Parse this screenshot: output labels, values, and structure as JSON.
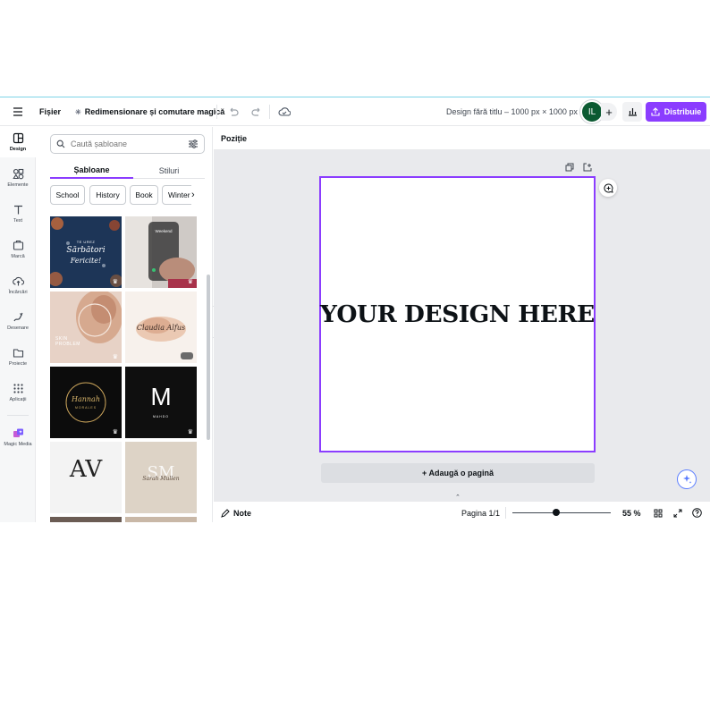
{
  "topbar": {
    "file_label": "Fișier",
    "magic_resize_label": "Redimensionare și comutare magică",
    "doc_title": "Design fără titlu – 1000 px × 1000 px",
    "avatar_initials": "IL",
    "share_label": "Distribuie",
    "icons": [
      "menu-icon",
      "sparkle-icon",
      "undo-icon",
      "redo-icon",
      "cloud-icon",
      "plus-icon",
      "insights-icon",
      "upload-icon"
    ]
  },
  "rail": {
    "items": [
      {
        "label": "Design",
        "icon": "design-icon"
      },
      {
        "label": "Elemente",
        "icon": "elements-icon"
      },
      {
        "label": "Text",
        "icon": "text-icon"
      },
      {
        "label": "Marcă",
        "icon": "brand-icon"
      },
      {
        "label": "Încărcări",
        "icon": "upload-cloud-icon"
      },
      {
        "label": "Desenare",
        "icon": "draw-icon"
      },
      {
        "label": "Proiecte",
        "icon": "folder-icon"
      },
      {
        "label": "Aplicații",
        "icon": "apps-icon"
      },
      {
        "label": "Magic Media",
        "icon": "magic-media-icon"
      }
    ]
  },
  "panel": {
    "search_placeholder": "Caută șabloane",
    "tabs": [
      "Șabloane",
      "Stiluri"
    ],
    "chips": [
      "School",
      "History",
      "Book",
      "Winter"
    ],
    "templates": [
      {
        "lines": [
          "TE UREZ",
          "Sărbători",
          "Fericite!"
        ]
      },
      {
        "lines": [
          "Weekend"
        ]
      },
      {
        "lines": [
          "SKIN",
          "PROBLEM"
        ]
      },
      {
        "lines": [
          "Claudia Alfus"
        ]
      },
      {
        "lines": [
          "Hannah",
          "MORALES"
        ]
      },
      {
        "lines": [
          "M",
          "MAHDO"
        ]
      },
      {
        "lines": [
          "AV"
        ]
      },
      {
        "lines": [
          "SM",
          "Sarah Mullen"
        ]
      }
    ]
  },
  "workspace": {
    "position_label": "Poziție",
    "design_text": "YOUR DESIGN HERE",
    "add_page_label": "+ Adaugă o pagină"
  },
  "footer": {
    "notes_label": "Note",
    "page_label": "Pagina 1/1",
    "zoom_label": "55 %",
    "zoom_value": 55
  },
  "colors": {
    "accent": "#8b3dff",
    "avatar_bg": "#0b5a32",
    "canvas_bg": "#e9eaed"
  }
}
